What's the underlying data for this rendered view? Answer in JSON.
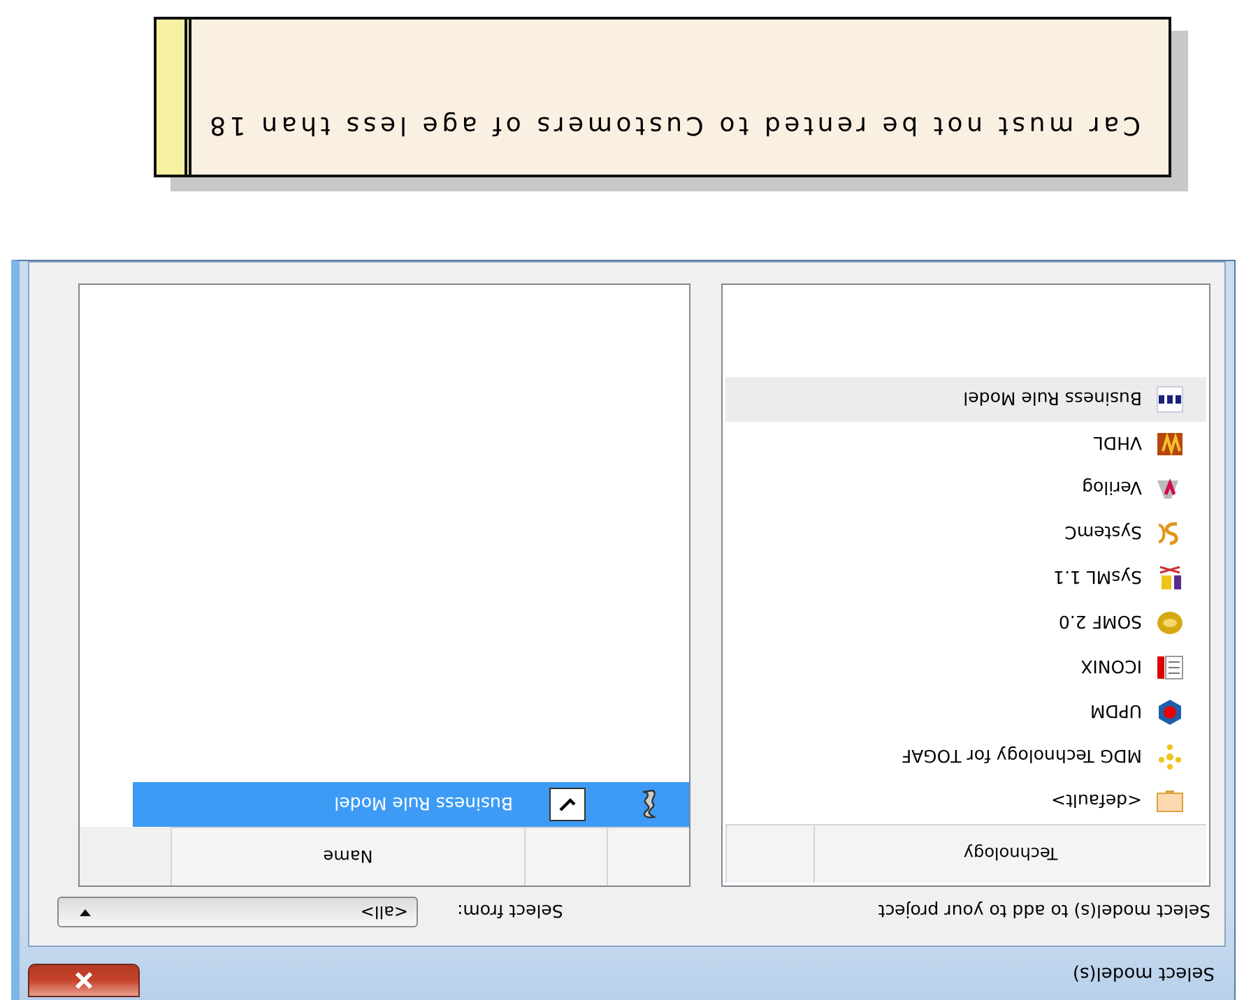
{
  "window": {
    "title": "Select model(s)"
  },
  "instruction": "Select model(s) to add to your project",
  "select_from": {
    "label": "Select from:",
    "value": "<all>"
  },
  "technology_list": {
    "columns": [
      "Technology"
    ],
    "items": [
      {
        "label": "<default>",
        "selected": false
      },
      {
        "label": "MDG Technology for TOGAF",
        "selected": false
      },
      {
        "label": "UPDM",
        "selected": false
      },
      {
        "label": "ICONIX",
        "selected": false
      },
      {
        "label": "SOMF 2.0",
        "selected": false
      },
      {
        "label": "SysML 1.1",
        "selected": false
      },
      {
        "label": "SystemC",
        "selected": false
      },
      {
        "label": "Verilog",
        "selected": false
      },
      {
        "label": "VHDL",
        "selected": false
      },
      {
        "label": "Business Rule Model",
        "selected": true
      }
    ]
  },
  "models_table": {
    "columns": [
      "Name"
    ],
    "rows": [
      {
        "name": "Business Rule Model",
        "checked": true,
        "selected": true
      }
    ]
  },
  "note": {
    "text": "Car must not be rented to Customers of age less than 18"
  }
}
